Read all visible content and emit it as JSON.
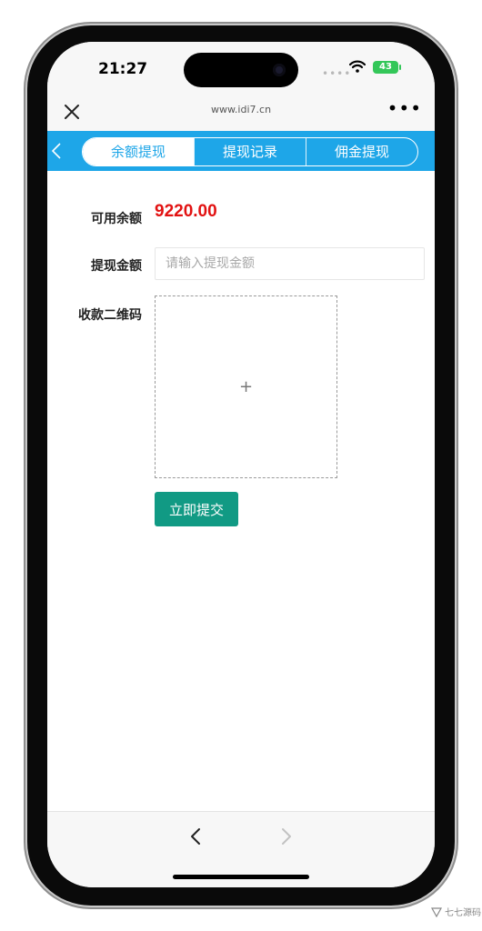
{
  "status_bar": {
    "time": "21:27",
    "battery": "43"
  },
  "browser": {
    "url": "www.idi7.cn"
  },
  "tabs": [
    {
      "label": "余额提现",
      "active": true
    },
    {
      "label": "提现记录",
      "active": false
    },
    {
      "label": "佣金提现",
      "active": false
    }
  ],
  "form": {
    "balance_label": "可用余额",
    "balance_value": "9220.00",
    "amount_label": "提现金额",
    "amount_placeholder": "请输入提现金额",
    "qrcode_label": "收款二维码",
    "upload_symbol": "+",
    "submit_label": "立即提交"
  },
  "watermark": {
    "text": "七七源码"
  },
  "colors": {
    "tab_bar": "#1ea6e8",
    "balance_value": "#e21212",
    "submit_button": "#119a84"
  }
}
